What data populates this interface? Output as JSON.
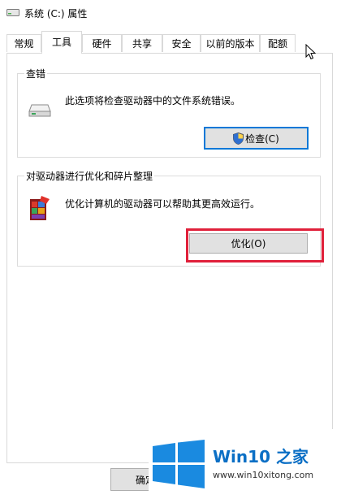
{
  "window": {
    "title": "系统 (C:) 属性"
  },
  "tabs": [
    {
      "label": "常规"
    },
    {
      "label": "工具",
      "active": true
    },
    {
      "label": "硬件"
    },
    {
      "label": "共享"
    },
    {
      "label": "安全"
    },
    {
      "label": "以前的版本"
    },
    {
      "label": "配额"
    }
  ],
  "error_check": {
    "group_title": "查错",
    "description": "此选项将检查驱动器中的文件系统错误。",
    "button_label": "检查(C)",
    "icon": "drive-icon"
  },
  "optimize": {
    "group_title": "对驱动器进行优化和碎片整理",
    "description": "优化计算机的驱动器可以帮助其更高效运行。",
    "button_label": "优化(O)",
    "icon": "defrag-icon"
  },
  "footer": {
    "ok_label": "确定"
  },
  "watermark": {
    "brand": "Win10 之家",
    "url": "www.win10xitong.com"
  },
  "colors": {
    "highlight": "#e0203a",
    "accent": "#0078d7",
    "brand": "#0b6fc5"
  }
}
